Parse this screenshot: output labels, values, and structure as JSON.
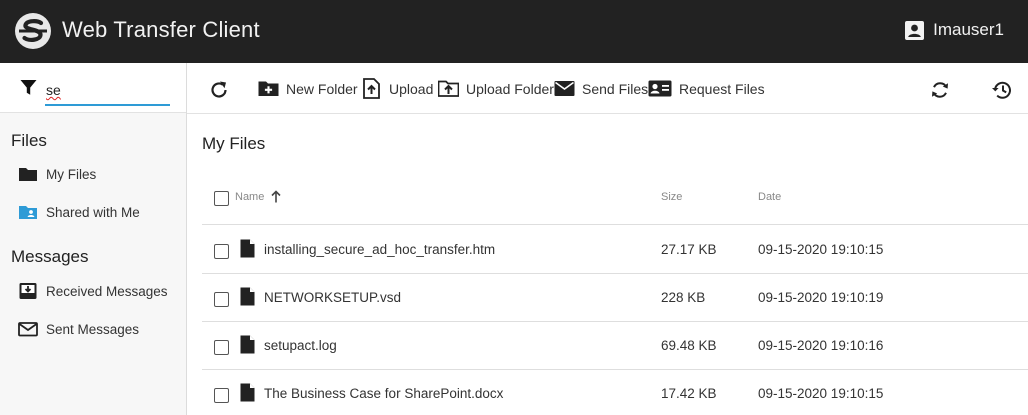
{
  "header": {
    "app_title": "Web Transfer Client",
    "user_name": "Imauser1"
  },
  "sidebar": {
    "filter_value": "se",
    "files_heading": "Files",
    "files_items": [
      {
        "label": "My Files",
        "icon": "folder-icon"
      },
      {
        "label": "Shared with Me",
        "icon": "shared-folder-icon"
      }
    ],
    "messages_heading": "Messages",
    "messages_items": [
      {
        "label": "Received Messages",
        "icon": "inbox-icon"
      },
      {
        "label": "Sent Messages",
        "icon": "envelope-icon"
      }
    ]
  },
  "toolbar": {
    "new_folder": "New Folder",
    "upload": "Upload",
    "upload_folder": "Upload Folder",
    "send_files": "Send Files",
    "request_files": "Request Files"
  },
  "main": {
    "title": "My Files",
    "columns": {
      "name": "Name",
      "size": "Size",
      "date": "Date"
    },
    "rows": [
      {
        "name": "installing_secure_ad_hoc_transfer.htm",
        "size": "27.17 KB",
        "date": "09-15-2020 19:10:15"
      },
      {
        "name": "NETWORKSETUP.vsd",
        "size": "228 KB",
        "date": "09-15-2020 19:10:19"
      },
      {
        "name": "setupact.log",
        "size": "69.48 KB",
        "date": "09-15-2020 19:10:16"
      },
      {
        "name": "The Business Case for SharePoint.docx",
        "size": "17.42 KB",
        "date": "09-15-2020 19:10:15"
      }
    ]
  },
  "colors": {
    "header_bg": "#222222",
    "accent": "#2e9bd6",
    "shared_folder": "#2e9bd6"
  }
}
